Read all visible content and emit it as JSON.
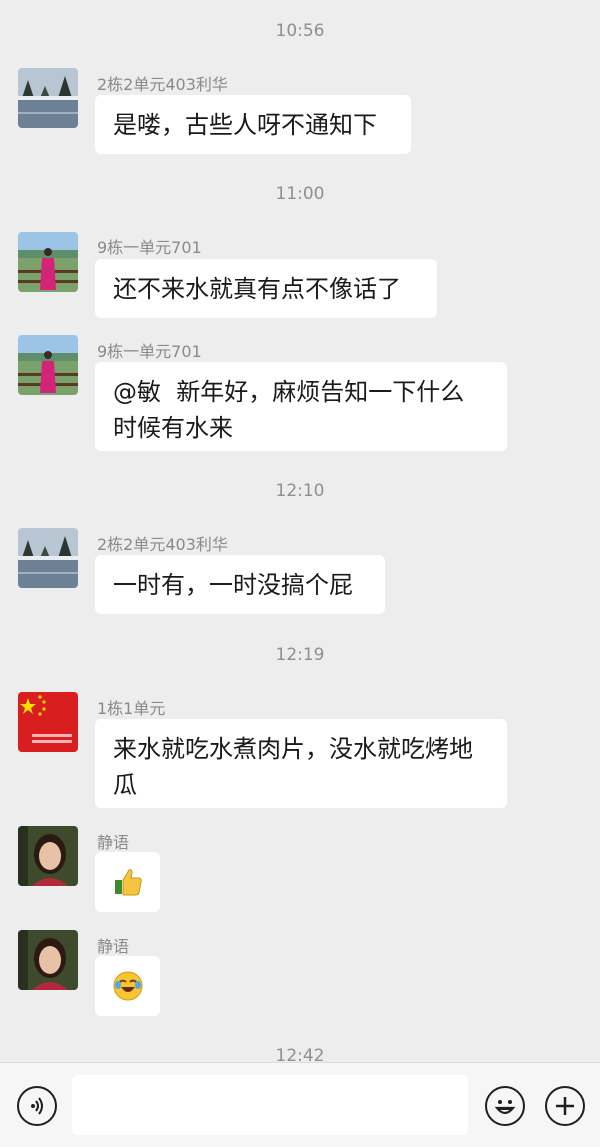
{
  "messages": {
    "t1": "10:56",
    "m1": {
      "sender": "2栋2单元403利华",
      "text": "是喽，古些人呀不通知下"
    },
    "t2": "11:00",
    "m2": {
      "sender": "9栋一单元701",
      "text": "还不来水就真有点不像话了"
    },
    "m3": {
      "sender": "9栋一单元701",
      "line1": "@敏  新年好，麻烦告知一下什么",
      "line2": "时候有水来"
    },
    "t3": "12:10",
    "m4": {
      "sender": "2栋2单元403利华",
      "text": "一时有，一时没搞个屁"
    },
    "t4": "12:19",
    "m5": {
      "sender": "1栋1单元",
      "line1": "来水就吃水煮肉片，没水就吃烤地",
      "line2": "瓜"
    },
    "m6": {
      "sender": "静语",
      "emoji": "thumbs-up"
    },
    "m7": {
      "sender": "静语",
      "emoji": "crying-laughing"
    },
    "t5": "12:42"
  },
  "input": {
    "placeholder": "",
    "value": ""
  },
  "icons": {
    "voice": "voice-icon",
    "emoji": "emoji-icon",
    "add": "plus-icon"
  }
}
